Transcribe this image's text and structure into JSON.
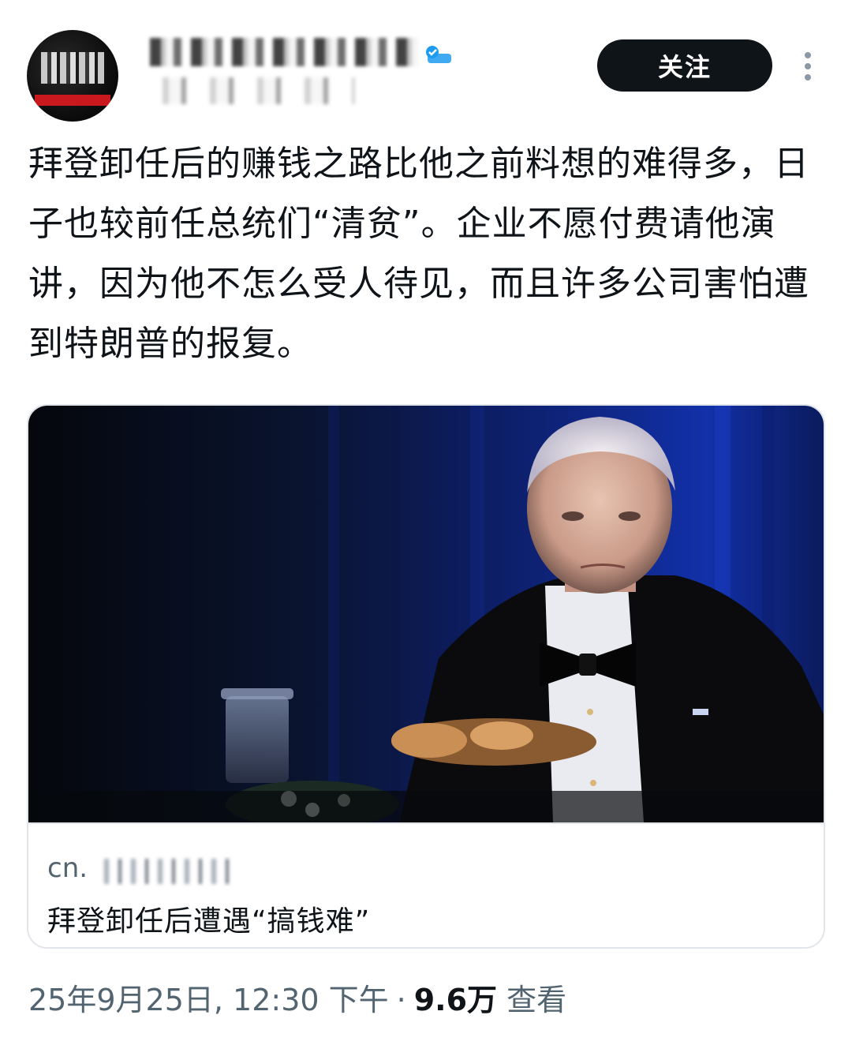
{
  "header": {
    "follow_label": "关注"
  },
  "tweet": {
    "text": "拜登卸任后的赚钱之路比他之前料想的难得多，日子也较前任总统们“清贫”。企业不愿付费请他演讲，因为他不怎么受人待见，而且许多公司害怕遭到特朗普的报复。"
  },
  "card": {
    "domain": "cn.",
    "title": "拜登卸任后遭遇“搞钱难”"
  },
  "meta": {
    "timestamp": "25年9月25日, 12:30 下午",
    "separator": "·",
    "views_count": "9.6万",
    "views_label": "查看"
  },
  "colors": {
    "accent": "#1d9bf0",
    "text_primary": "#0f1419",
    "text_secondary": "#536471",
    "border": "#e1e5ea"
  },
  "icons": {
    "verified": "verified-badge-icon",
    "more": "more-vertical-icon"
  }
}
